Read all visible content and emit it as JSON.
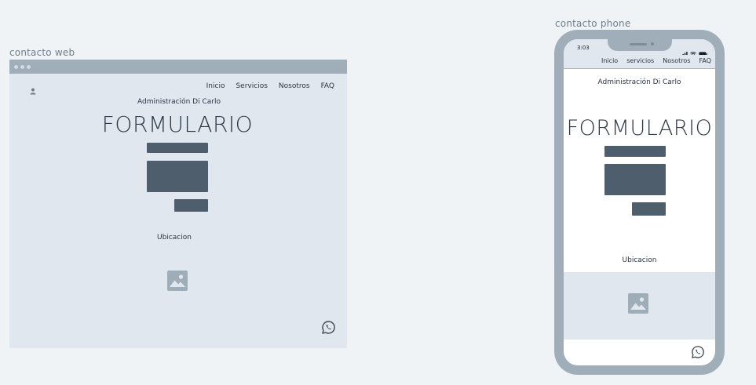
{
  "web": {
    "frame_label": "contacto web",
    "nav": [
      "Inicio",
      "Servicios",
      "Nosotros",
      "FAQ"
    ],
    "subtitle": "Administración Di Carlo",
    "form_title": "FORMULARIO",
    "location_label": "Ubicacion",
    "icons": [
      "user-icon",
      "image-icon",
      "whatsapp-icon"
    ]
  },
  "phone": {
    "frame_label": "contacto phone",
    "time": "3:03",
    "nav": [
      "Inicio",
      "servicios",
      "Nosotros",
      "FAQ"
    ],
    "subtitle": "Administración Di Carlo",
    "form_title": "FORMULARIO",
    "location_label": "Ubicacion",
    "icons": [
      "signal-icon",
      "wifi-icon",
      "battery-icon",
      "image-icon",
      "whatsapp-icon"
    ]
  },
  "colors": {
    "canvas": "#f0f3f6",
    "frame": "#a0aeba",
    "surface": "#e1e7ef",
    "block": "#4f5e6d",
    "text": "#2b3440"
  }
}
